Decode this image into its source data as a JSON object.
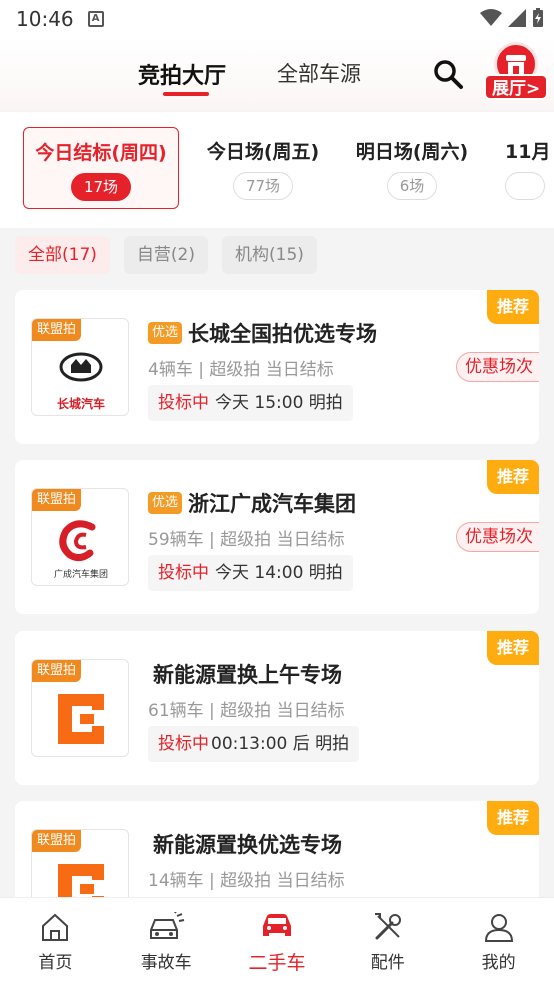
{
  "status_bar": {
    "time": "10:46",
    "indicator": "A"
  },
  "header": {
    "tabs": [
      {
        "label": "竞拍大厅",
        "active": true
      },
      {
        "label": "全部车源",
        "active": false
      }
    ],
    "search_icon": "search-icon",
    "hall_label": "展厅>"
  },
  "day_tabs": [
    {
      "title": "今日结标(周四)",
      "count": "17场",
      "active": true
    },
    {
      "title": "今日场(周五)",
      "count": "77场",
      "active": false
    },
    {
      "title": "明日场(周六)",
      "count": "6场",
      "active": false
    },
    {
      "title": "11月",
      "count": "",
      "active": false
    }
  ],
  "filters": [
    {
      "label": "全部(17)",
      "active": true
    },
    {
      "label": "自营(2)",
      "active": false
    },
    {
      "label": "机构(15)",
      "active": false
    }
  ],
  "auctions": [
    {
      "logo_tag": "联盟拍",
      "logo_brand": "长城汽车",
      "recommend": "推荐",
      "pick_badge": "优选",
      "title": "长城全国拍优选专场",
      "meta": "4辆车 | 超级拍 当日结标",
      "discount": "优惠场次",
      "status": "投标中",
      "time": "今天 15:00 明拍"
    },
    {
      "logo_tag": "联盟拍",
      "logo_brand": "广成汽车集团",
      "recommend": "推荐",
      "pick_badge": "优选",
      "title": "浙江广成汽车集团",
      "meta": "59辆车 | 超级拍 当日结标",
      "discount": "优惠场次",
      "status": "投标中",
      "time": "今天 14:00 明拍"
    },
    {
      "logo_tag": "联盟拍",
      "recommend": "推荐",
      "title": "新能源置换上午专场",
      "meta": "61辆车 | 超级拍 当日结标",
      "status": "投标中",
      "time": "00:13:00 后 明拍"
    },
    {
      "logo_tag": "联盟拍",
      "recommend": "推荐",
      "title": "新能源置换优选专场",
      "meta": "14辆车 | 超级拍 当日结标"
    }
  ],
  "bottom_nav": [
    {
      "label": "首页",
      "icon": "home-icon",
      "active": false
    },
    {
      "label": "事故车",
      "icon": "accident-car-icon",
      "active": false
    },
    {
      "label": "二手车",
      "icon": "used-car-icon",
      "active": true
    },
    {
      "label": "配件",
      "icon": "tools-icon",
      "active": false
    },
    {
      "label": "我的",
      "icon": "profile-icon",
      "active": false
    }
  ],
  "colors": {
    "accent": "#e5222a",
    "recommend": "#ffac11",
    "tag": "#f08a1f"
  }
}
